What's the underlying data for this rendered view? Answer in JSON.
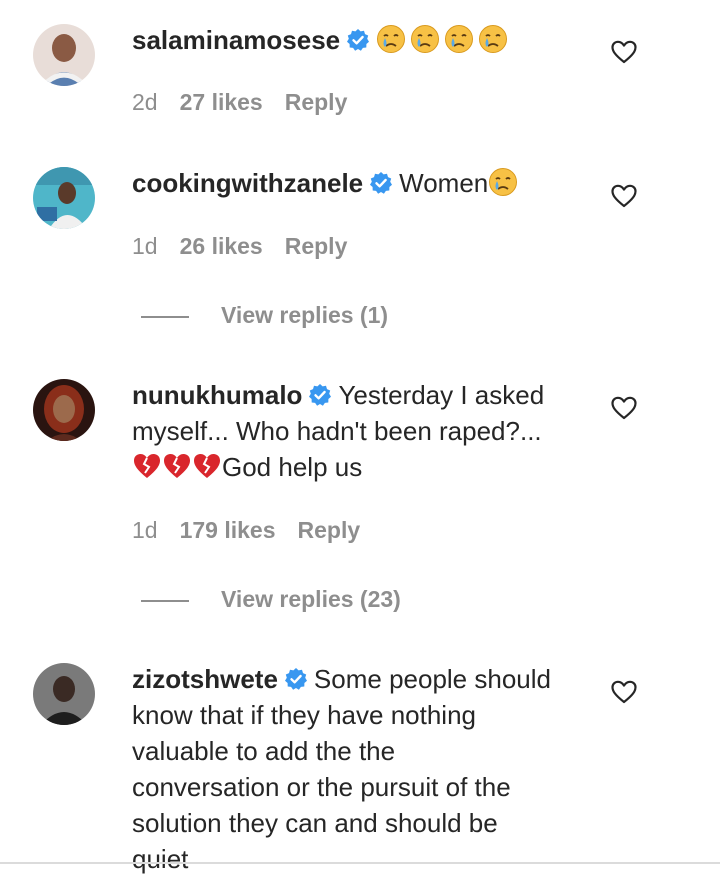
{
  "comments": [
    {
      "username": "salaminamosese",
      "verified": true,
      "text": "",
      "emojis": [
        "crying-face",
        "crying-face",
        "crying-face",
        "crying-face"
      ],
      "age": "2d",
      "likes": "27 likes",
      "reply": "Reply",
      "avatar_color": "#c9a79a"
    },
    {
      "username": "cookingwithzanele",
      "verified": true,
      "text": "Women",
      "emojis": [
        "crying-face"
      ],
      "age": "1d",
      "likes": "26 likes",
      "reply": "Reply",
      "avatar_color": "#4fb6c9",
      "view_replies": "View replies (1)"
    },
    {
      "username": "nunukhumalo",
      "verified": true,
      "text_line1": "Yesterday I asked",
      "text_line2": "myself... Who hadn't been raped?...",
      "text_line3": "God help us",
      "emojis": [
        "broken-heart",
        "broken-heart",
        "broken-heart"
      ],
      "age": "1d",
      "likes": "179 likes",
      "reply": "Reply",
      "avatar_color": "#6b2a1c",
      "view_replies": "View replies (23)"
    },
    {
      "username": "zizotshwete",
      "verified": true,
      "text_line1": "Some people should",
      "text_line2": "know that if they have nothing",
      "text_line3": "valuable to add the the",
      "text_line4": "conversation or the pursuit of the",
      "text_line5": "solution they can and should be",
      "text_line6": "quiet",
      "avatar_color": "#3a3a3a"
    }
  ],
  "colors": {
    "verified": "#3897f0",
    "secondary_text": "#8e8e8e",
    "primary_text": "#262626"
  }
}
